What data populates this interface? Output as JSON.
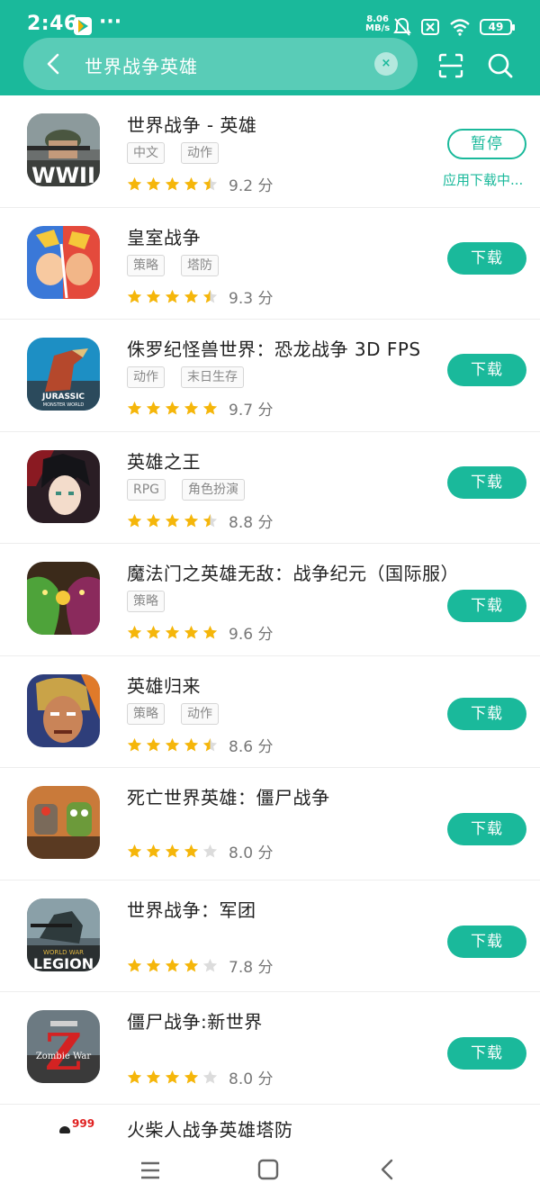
{
  "status": {
    "time": "2:46",
    "dots": "···",
    "net_speed_top": "8.06",
    "net_speed_bottom": "MB/s",
    "battery": "49"
  },
  "search": {
    "query": "世界战争英雄",
    "clear_symbol": "×"
  },
  "colors": {
    "accent": "#1ab99b",
    "star": "#f5b60a",
    "star_empty": "#dcdcdc"
  },
  "apps": [
    {
      "name": "世界战争 - 英雄",
      "tags": [
        "中文",
        "动作"
      ],
      "stars": 4.5,
      "score": "9.2 分",
      "action": "暂停",
      "status_text": "应用下载中..."
    },
    {
      "name": "皇室战争",
      "tags": [
        "策略",
        "塔防"
      ],
      "stars": 4.5,
      "score": "9.3 分",
      "action": "下载"
    },
    {
      "name": "侏罗纪怪兽世界：恐龙战争 3D FPS",
      "tags": [
        "动作",
        "末日生存"
      ],
      "stars": 5,
      "score": "9.7 分",
      "action": "下载",
      "icon_text_1": "JURASSIC",
      "icon_text_2": "MONSTER WORLD"
    },
    {
      "name": "英雄之王",
      "tags": [
        "RPG",
        "角色扮演"
      ],
      "stars": 4.5,
      "score": "8.8 分",
      "action": "下载"
    },
    {
      "name": "魔法门之英雄无敌：战争纪元（国际服）",
      "tags": [
        "策略"
      ],
      "stars": 5,
      "score": "9.6 分",
      "action": "下载"
    },
    {
      "name": "英雄归来",
      "tags": [
        "策略",
        "动作"
      ],
      "stars": 4.5,
      "score": "8.6 分",
      "action": "下载"
    },
    {
      "name": "死亡世界英雄：僵尸战争",
      "tags": [],
      "stars": 4,
      "score": "8.0 分",
      "action": "下载"
    },
    {
      "name": "世界战争：军团",
      "tags": [],
      "stars": 4,
      "score": "7.8 分",
      "action": "下载",
      "icon_text_1": "WORLD WAR",
      "icon_text_2": "LEGION"
    },
    {
      "name": "僵尸战争:新世界",
      "tags": [],
      "stars": 4,
      "score": "8.0 分",
      "action": "下载",
      "icon_text_1": "Z",
      "icon_text_2": "Zombie War"
    },
    {
      "name": "火柴人战争英雄塔防",
      "badge": "999"
    }
  ],
  "icons": {
    "app0_logo": "WWII",
    "app0": "soldier-icon",
    "app1": "clash-royale-icon",
    "app2": "dinosaur-icon",
    "app3": "anime-hero-icon",
    "app4": "dragons-icon",
    "app5": "warrior-icon",
    "app6": "zombie-icon",
    "app7": "legion-icon",
    "app8": "zombie-war-icon"
  }
}
